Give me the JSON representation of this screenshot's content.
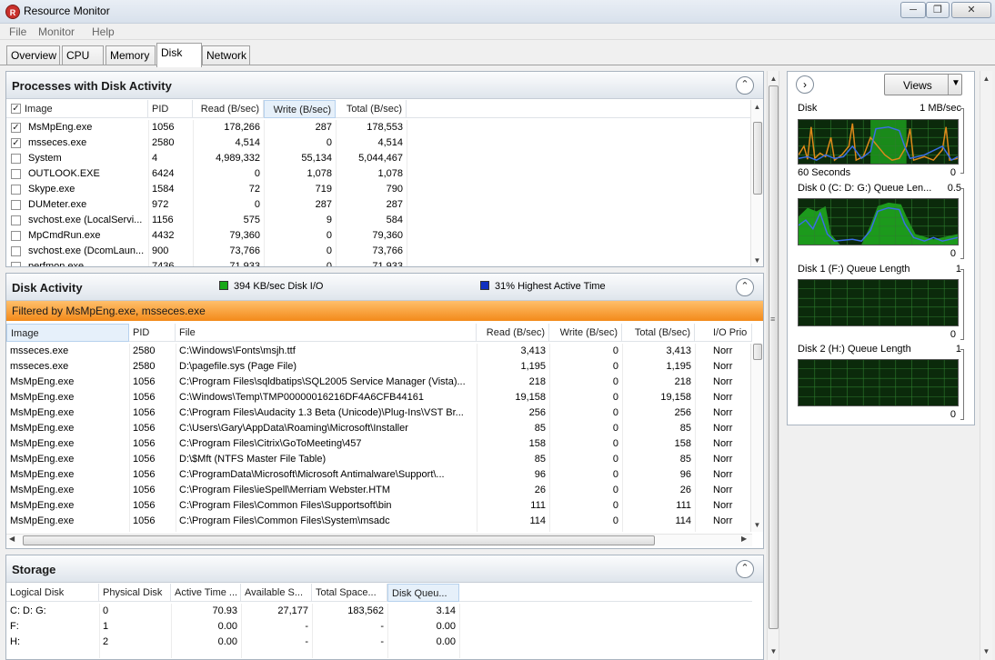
{
  "window": {
    "title": "Resource Monitor",
    "icon_text": "R"
  },
  "menu": [
    "File",
    "Monitor",
    "Help"
  ],
  "tabs": [
    "Overview",
    "CPU",
    "Memory",
    "Disk",
    "Network"
  ],
  "processes": {
    "title": "Processes with Disk Activity",
    "columns": [
      "Image",
      "PID",
      "Read (B/sec)",
      "Write (B/sec)",
      "Total (B/sec)"
    ],
    "rows": [
      {
        "checked": true,
        "image": "MsMpEng.exe",
        "pid": "1056",
        "read": "178,266",
        "write": "287",
        "total": "178,553"
      },
      {
        "checked": true,
        "image": "msseces.exe",
        "pid": "2580",
        "read": "4,514",
        "write": "0",
        "total": "4,514"
      },
      {
        "checked": false,
        "image": "System",
        "pid": "4",
        "read": "4,989,332",
        "write": "55,134",
        "total": "5,044,467"
      },
      {
        "checked": false,
        "image": "OUTLOOK.EXE",
        "pid": "6424",
        "read": "0",
        "write": "1,078",
        "total": "1,078"
      },
      {
        "checked": false,
        "image": "Skype.exe",
        "pid": "1584",
        "read": "72",
        "write": "719",
        "total": "790"
      },
      {
        "checked": false,
        "image": "DUMeter.exe",
        "pid": "972",
        "read": "0",
        "write": "287",
        "total": "287"
      },
      {
        "checked": false,
        "image": "svchost.exe (LocalServi...",
        "pid": "1156",
        "read": "575",
        "write": "9",
        "total": "584"
      },
      {
        "checked": false,
        "image": "MpCmdRun.exe",
        "pid": "4432",
        "read": "79,360",
        "write": "0",
        "total": "79,360"
      },
      {
        "checked": false,
        "image": "svchost.exe (DcomLaun...",
        "pid": "900",
        "read": "73,766",
        "write": "0",
        "total": "73,766"
      },
      {
        "checked": false,
        "image": "perfmon.exe",
        "pid": "7436",
        "read": "71,933",
        "write": "0",
        "total": "71,933"
      }
    ]
  },
  "disk_activity": {
    "title": "Disk Activity",
    "legend_io": "394 KB/sec Disk I/O",
    "legend_active": "31% Highest Active Time",
    "legend_io_color": "#18a818",
    "legend_active_color": "#1030c0",
    "filter": "Filtered by MsMpEng.exe, msseces.exe",
    "columns": [
      "Image",
      "PID",
      "File",
      "Read (B/sec)",
      "Write (B/sec)",
      "Total (B/sec)",
      "I/O Prio"
    ],
    "rows": [
      {
        "image": "msseces.exe",
        "pid": "2580",
        "file": "C:\\Windows\\Fonts\\msjh.ttf",
        "read": "3,413",
        "write": "0",
        "total": "3,413",
        "prio": "Norr"
      },
      {
        "image": "msseces.exe",
        "pid": "2580",
        "file": "D:\\pagefile.sys (Page File)",
        "read": "1,195",
        "write": "0",
        "total": "1,195",
        "prio": "Norr"
      },
      {
        "image": "MsMpEng.exe",
        "pid": "1056",
        "file": "C:\\Program Files\\sqldbatips\\SQL2005 Service Manager (Vista)...",
        "read": "218",
        "write": "0",
        "total": "218",
        "prio": "Norr"
      },
      {
        "image": "MsMpEng.exe",
        "pid": "1056",
        "file": "C:\\Windows\\Temp\\TMP00000016216DF4A6CFB44161",
        "read": "19,158",
        "write": "0",
        "total": "19,158",
        "prio": "Norr"
      },
      {
        "image": "MsMpEng.exe",
        "pid": "1056",
        "file": "C:\\Program Files\\Audacity 1.3 Beta (Unicode)\\Plug-Ins\\VST Br...",
        "read": "256",
        "write": "0",
        "total": "256",
        "prio": "Norr"
      },
      {
        "image": "MsMpEng.exe",
        "pid": "1056",
        "file": "C:\\Users\\Gary\\AppData\\Roaming\\Microsoft\\Installer",
        "read": "85",
        "write": "0",
        "total": "85",
        "prio": "Norr"
      },
      {
        "image": "MsMpEng.exe",
        "pid": "1056",
        "file": "C:\\Program Files\\Citrix\\GoToMeeting\\457",
        "read": "158",
        "write": "0",
        "total": "158",
        "prio": "Norr"
      },
      {
        "image": "MsMpEng.exe",
        "pid": "1056",
        "file": "D:\\$Mft (NTFS Master File Table)",
        "read": "85",
        "write": "0",
        "total": "85",
        "prio": "Norr"
      },
      {
        "image": "MsMpEng.exe",
        "pid": "1056",
        "file": "C:\\ProgramData\\Microsoft\\Microsoft Antimalware\\Support\\...",
        "read": "96",
        "write": "0",
        "total": "96",
        "prio": "Norr"
      },
      {
        "image": "MsMpEng.exe",
        "pid": "1056",
        "file": "C:\\Program Files\\ieSpell\\Merriam Webster.HTM",
        "read": "26",
        "write": "0",
        "total": "26",
        "prio": "Norr"
      },
      {
        "image": "MsMpEng.exe",
        "pid": "1056",
        "file": "C:\\Program Files\\Common Files\\Supportsoft\\bin",
        "read": "111",
        "write": "0",
        "total": "111",
        "prio": "Norr"
      },
      {
        "image": "MsMpEng.exe",
        "pid": "1056",
        "file": "C:\\Program Files\\Common Files\\System\\msadc",
        "read": "114",
        "write": "0",
        "total": "114",
        "prio": "Norr"
      }
    ]
  },
  "storage": {
    "title": "Storage",
    "columns": [
      "Logical Disk",
      "Physical Disk",
      "Active Time ...",
      "Available S...",
      "Total Space...",
      "Disk Queu..."
    ],
    "rows": [
      {
        "logical": "C: D: G:",
        "physical": "0",
        "active": "70.93",
        "available": "27,177",
        "total": "183,562",
        "queue": "3.14"
      },
      {
        "logical": "F:",
        "physical": "1",
        "active": "0.00",
        "available": "-",
        "total": "-",
        "queue": "0.00"
      },
      {
        "logical": "H:",
        "physical": "2",
        "active": "0.00",
        "available": "-",
        "total": "-",
        "queue": "0.00"
      }
    ]
  },
  "right": {
    "views_label": "Views",
    "graphs": [
      {
        "title": "Disk",
        "max": "1 MB/sec",
        "footer_left": "60 Seconds",
        "footer_right": "0"
      },
      {
        "title": "Disk 0 (C: D: G:) Queue Len...",
        "max": "0.5",
        "footer_left": "",
        "footer_right": "0"
      },
      {
        "title": "Disk 1 (F:) Queue Length",
        "max": "1",
        "footer_left": "",
        "footer_right": "0"
      },
      {
        "title": "Disk 2 (H:) Queue Length",
        "max": "1",
        "footer_left": "",
        "footer_right": "0"
      }
    ]
  }
}
